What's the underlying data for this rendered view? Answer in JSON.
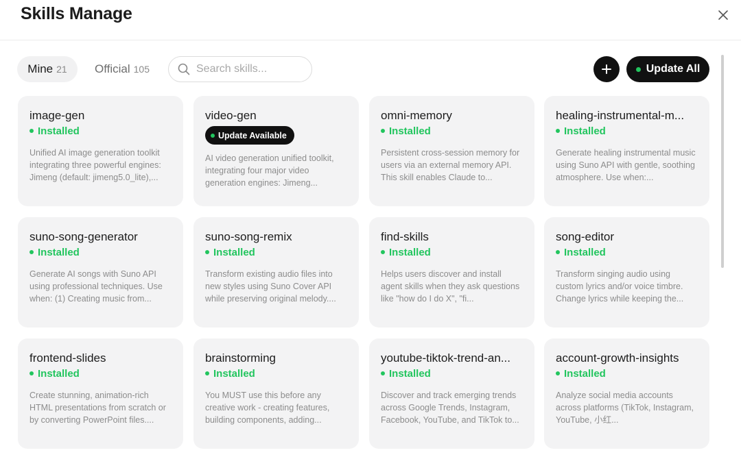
{
  "header": {
    "title": "Skills Manage",
    "close_icon": "close-icon"
  },
  "tabs": {
    "mine": {
      "label": "Mine",
      "count": "21"
    },
    "official": {
      "label": "Official",
      "count": "105"
    }
  },
  "search": {
    "placeholder": "Search skills...",
    "value": ""
  },
  "actions": {
    "update_all_label": "Update All",
    "add_icon": "plus-icon"
  },
  "colors": {
    "installed": "#22c55e",
    "primary": "#111111",
    "card_bg": "#f3f3f4"
  },
  "skills": [
    {
      "name": "image-gen",
      "status": "Installed",
      "description": "Unified AI image generation toolkit integrating three powerful engines: Jimeng (default: jimeng5.0_lite),..."
    },
    {
      "name": "video-gen",
      "status": "Update Available",
      "description": "AI video generation unified toolkit, integrating four major video generation engines: Jimeng..."
    },
    {
      "name": "omni-memory",
      "status": "Installed",
      "description": "Persistent cross-session memory for users via an external memory API. This skill enables Claude to..."
    },
    {
      "name": "healing-instrumental-m...",
      "status": "Installed",
      "description": "Generate healing instrumental music using Suno API with gentle, soothing atmosphere. Use when:..."
    },
    {
      "name": "suno-song-generator",
      "status": "Installed",
      "description": "Generate AI songs with Suno API using professional techniques. Use when: (1) Creating music from..."
    },
    {
      "name": "suno-song-remix",
      "status": "Installed",
      "description": "Transform existing audio files into new styles using Suno Cover API while preserving original melody...."
    },
    {
      "name": "find-skills",
      "status": "Installed",
      "description": "Helps users discover and install agent skills when they ask questions like \"how do I do X\", \"fi..."
    },
    {
      "name": "song-editor",
      "status": "Installed",
      "description": "Transform singing audio using custom lyrics and/or voice timbre. Change lyrics while keeping the..."
    },
    {
      "name": "frontend-slides",
      "status": "Installed",
      "description": "Create stunning, animation-rich HTML presentations from scratch or by converting PowerPoint files...."
    },
    {
      "name": "brainstorming",
      "status": "Installed",
      "description": "You MUST use this before any creative work - creating features, building components, adding..."
    },
    {
      "name": "youtube-tiktok-trend-an...",
      "status": "Installed",
      "description": "Discover and track emerging trends across Google Trends, Instagram, Facebook, YouTube, and TikTok to..."
    },
    {
      "name": "account-growth-insights",
      "status": "Installed",
      "description": "Analyze social media accounts across platforms (TikTok, Instagram, YouTube, 小红..."
    }
  ]
}
